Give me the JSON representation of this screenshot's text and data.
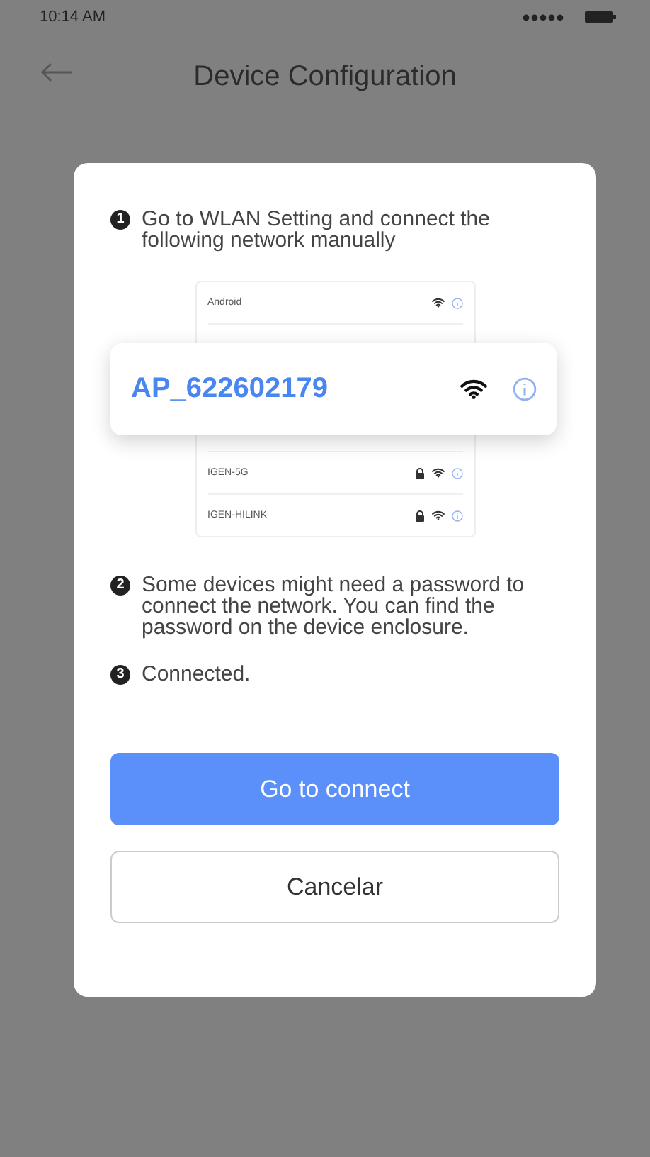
{
  "status_bar": {
    "time": "10:14 AM"
  },
  "header": {
    "title": "Device Configuration"
  },
  "dialog": {
    "steps": [
      {
        "number": "1",
        "text": "Go to WLAN Setting and connect the following network manually"
      },
      {
        "number": "2",
        "text": "Some devices might need a password to connect the network. You can find the password on the device enclosure."
      },
      {
        "number": "3",
        "text": "Connected."
      }
    ],
    "networks": [
      {
        "name": "Android",
        "locked": false
      },
      {
        "name": "IGEN-5G",
        "locked": true
      },
      {
        "name": "IGEN-HILINK",
        "locked": true
      }
    ],
    "highlighted_network": {
      "name": "AP_622602179"
    },
    "buttons": [
      {
        "label": "Go to connect",
        "kind": "primary"
      },
      {
        "label": "Cancelar",
        "kind": "secondary"
      }
    ]
  }
}
